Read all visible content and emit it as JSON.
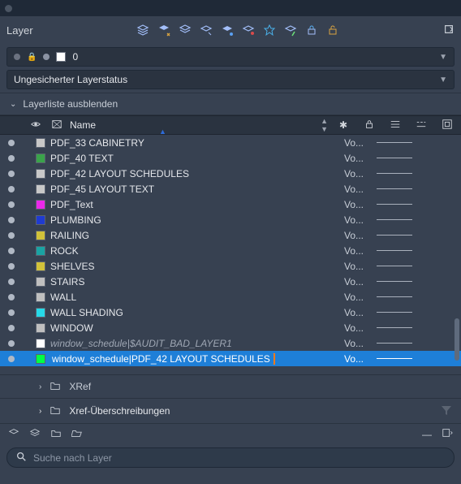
{
  "title": "Layer",
  "current_layer": {
    "index": "0"
  },
  "layer_status": "Ungesicherter Layerstatus",
  "collapser_label": "Layerliste ausblenden",
  "headers": {
    "name": "Name"
  },
  "layers": [
    {
      "color": "#c8c8c8",
      "name": "PDF_33 CABINETRY",
      "vo": "Vo..."
    },
    {
      "color": "#3aa34a",
      "name": "PDF_40 TEXT",
      "vo": "Vo..."
    },
    {
      "color": "#c8c8c8",
      "name": "PDF_42 LAYOUT SCHEDULES",
      "vo": "Vo..."
    },
    {
      "color": "#c8c8c8",
      "name": "PDF_45 LAYOUT TEXT",
      "vo": "Vo..."
    },
    {
      "color": "#ea28ea",
      "name": "PDF_Text",
      "vo": "Vo..."
    },
    {
      "color": "#1f3bd1",
      "name": "PLUMBING",
      "vo": "Vo..."
    },
    {
      "color": "#d1c23a",
      "name": "RAILING",
      "vo": "Vo..."
    },
    {
      "color": "#1aa3a3",
      "name": "ROCK",
      "vo": "Vo..."
    },
    {
      "color": "#d1c23a",
      "name": "SHELVES",
      "vo": "Vo..."
    },
    {
      "color": "#bfbfbf",
      "name": "STAIRS",
      "vo": "Vo..."
    },
    {
      "color": "#bfbfbf",
      "name": "WALL",
      "vo": "Vo..."
    },
    {
      "color": "#26d9e8",
      "name": "WALL SHADING",
      "vo": "Vo..."
    },
    {
      "color": "#bfbfbf",
      "name": "WINDOW",
      "vo": "Vo..."
    },
    {
      "color": "#ffffff",
      "name": "window_schedule|$AUDIT_BAD_LAYER1",
      "vo": "Vo...",
      "italic": true
    },
    {
      "color": "#00ff44",
      "name": "window_schedule|PDF_42 LAYOUT SCHEDULES",
      "vo": "Vo...",
      "selected": true
    }
  ],
  "sections": {
    "xref": "XRef",
    "xref_overrides": "Xref-Überschreibungen"
  },
  "search_placeholder": "Suche nach Layer"
}
